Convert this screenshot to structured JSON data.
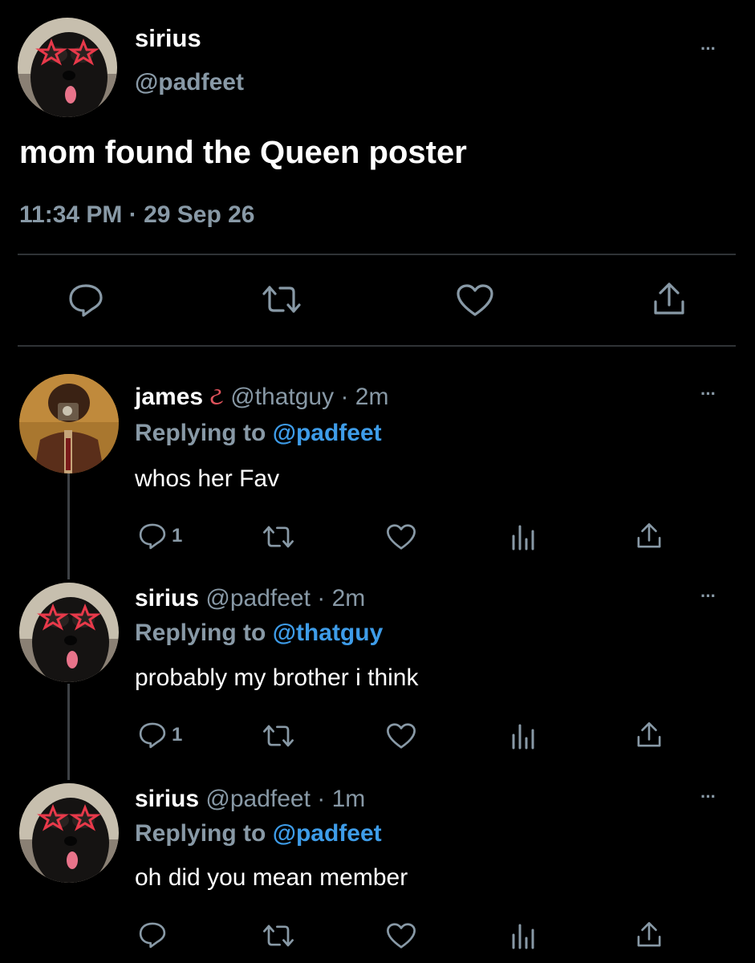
{
  "main_tweet": {
    "display_name": "sirius",
    "handle": "@padfeet",
    "text": "mom found the Queen poster",
    "timestamp": "11:34 PM · 29 Sep 26",
    "more": "···"
  },
  "replies": [
    {
      "display_name": "james",
      "badge": "ટ",
      "handle": "@thatguy",
      "time": "· 2m",
      "replying_prefix": "Replying to",
      "replying_to": "@padfeet",
      "text": "whos her Fav",
      "reply_count": "1",
      "more": "···"
    },
    {
      "display_name": "sirius",
      "handle": "@padfeet",
      "time": "· 2m",
      "replying_prefix": "Replying to",
      "replying_to": "@thatguy",
      "text": "probably my brother i think",
      "reply_count": "1",
      "more": "···"
    },
    {
      "display_name": "sirius",
      "handle": "@padfeet",
      "time": "· 1m",
      "replying_prefix": "Replying to",
      "replying_to": "@padfeet",
      "text": "oh did you mean member",
      "reply_count": "",
      "more": "···"
    }
  ],
  "icons": [
    "reply-icon",
    "retweet-icon",
    "like-icon",
    "analytics-icon",
    "share-icon",
    "more-icon"
  ],
  "colors": {
    "background": "#000000",
    "secondary_text": "#8899a6",
    "link": "#3e9ce8",
    "divider": "#2f3336"
  }
}
